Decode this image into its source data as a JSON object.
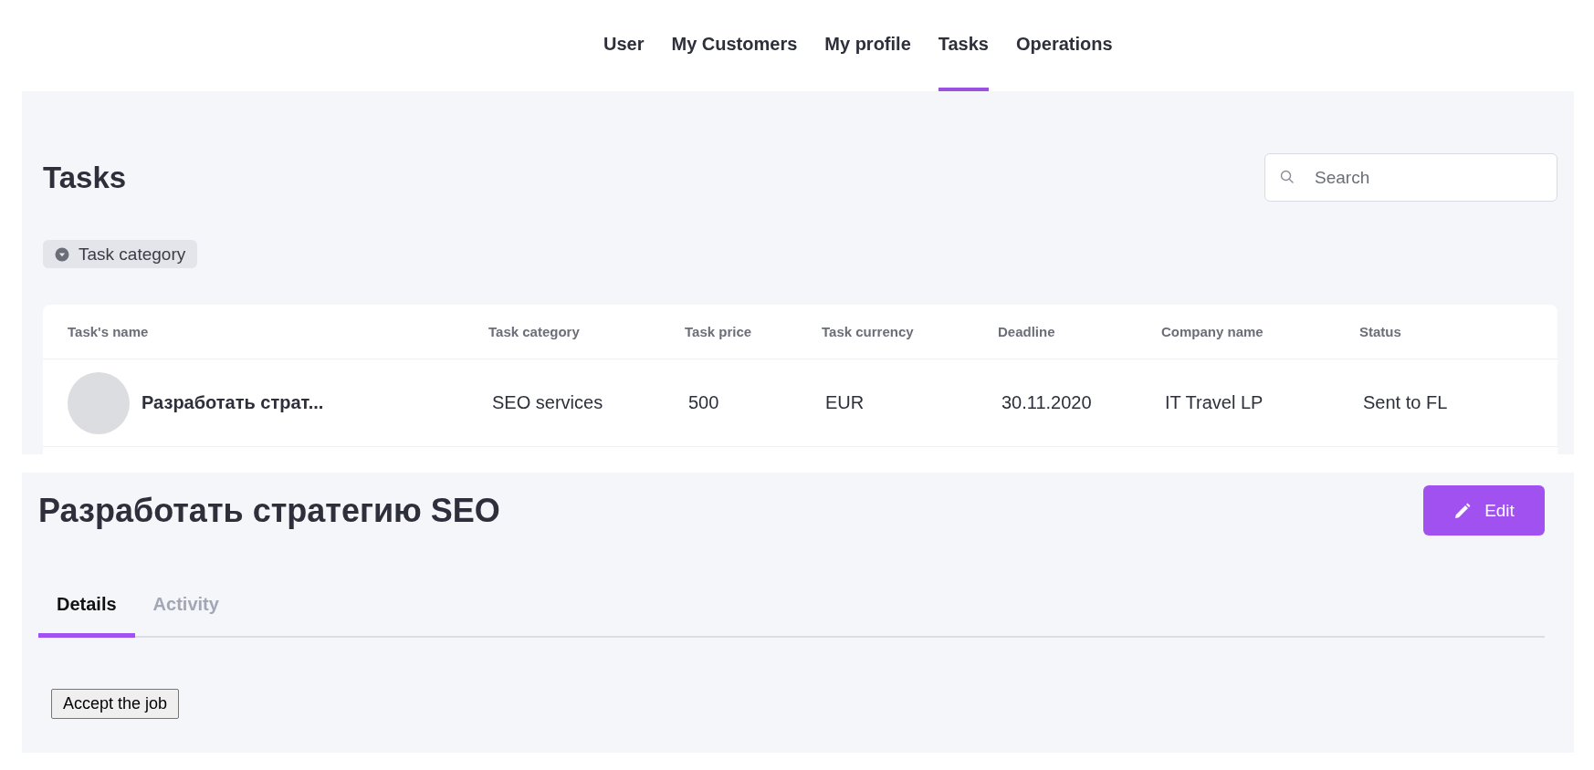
{
  "nav": [
    {
      "label": "User",
      "selected": false
    },
    {
      "label": "My Customers",
      "selected": false
    },
    {
      "label": "My profile",
      "selected": false
    },
    {
      "label": "Tasks",
      "selected": true
    },
    {
      "label": "Operations",
      "selected": false
    }
  ],
  "tasks_page": {
    "title": "Tasks",
    "search": {
      "placeholder": "Search"
    },
    "filter_chip": "Task category",
    "table": {
      "columns": [
        "Task's name",
        "Task category",
        "Task price",
        "Task currency",
        "Deadline",
        "Company name",
        "Status"
      ],
      "rows": [
        {
          "cells": [
            "Разработать страт...",
            "SEO services",
            "500",
            "EUR",
            "30.11.2020",
            "IT Travel LP",
            "Sent to FL"
          ]
        }
      ]
    }
  },
  "task_detail": {
    "title": "Разработать стратегию SEO",
    "edit_button": "Edit",
    "tabs": [
      {
        "label": "Details",
        "selected": true
      },
      {
        "label": "Activity",
        "selected": false
      }
    ],
    "accept_button": "Accept the job"
  }
}
